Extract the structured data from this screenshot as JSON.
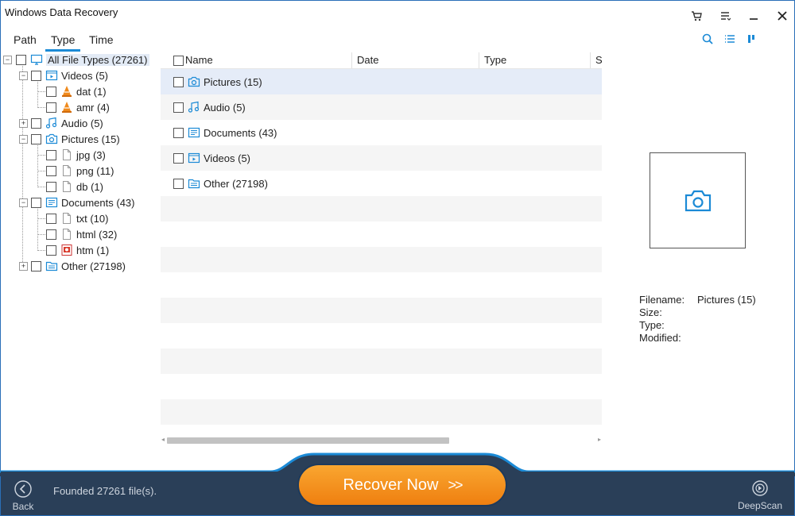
{
  "window": {
    "title": "Windows Data Recovery"
  },
  "tabs": [
    {
      "label": "Path"
    },
    {
      "label": "Type"
    },
    {
      "label": "Time"
    }
  ],
  "tree": {
    "root": "All File Types (27261)",
    "videos": "Videos (5)",
    "dat": "dat (1)",
    "amr": "amr (4)",
    "audio": "Audio (5)",
    "pictures": "Pictures (15)",
    "jpg": "jpg (3)",
    "png": "png (11)",
    "db": "db (1)",
    "documents": "Documents (43)",
    "txt": "txt (10)",
    "html": "html (32)",
    "htm": "htm (1)",
    "other": "Other (27198)"
  },
  "list": {
    "columns": [
      "Name",
      "Date",
      "Type",
      "S"
    ],
    "rows": [
      {
        "name": "Pictures (15)"
      },
      {
        "name": "Audio (5)"
      },
      {
        "name": "Documents (43)"
      },
      {
        "name": "Videos (5)"
      },
      {
        "name": "Other (27198)"
      }
    ]
  },
  "info": {
    "filename_label": "Filename:",
    "filename_value": "Pictures (15)",
    "size_label": "Size:",
    "type_label": "Type:",
    "modified_label": "Modified:"
  },
  "footer": {
    "back_label": "Back",
    "status": "Founded 27261 file(s).",
    "recover_label": "Recover Now",
    "recover_arrows": ">>",
    "deepscan_label": "DeepScan"
  },
  "colors": {
    "accent": "#1b8ad6",
    "footer_bg": "#2a3f58",
    "button_orange": "#f39420"
  }
}
